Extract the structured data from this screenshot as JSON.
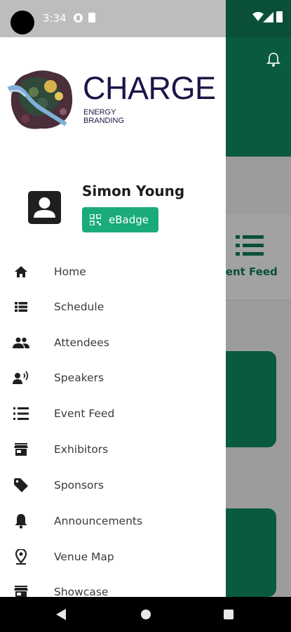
{
  "status_bar": {
    "time": "3:34"
  },
  "background_screen": {
    "tab_label": "vent Feed"
  },
  "brand": {
    "name": "CHARGE",
    "sub_line1": "ENERGY",
    "sub_line2": "BRANDING"
  },
  "user": {
    "name": "Simon Young",
    "badge_label": "eBadge"
  },
  "menu": {
    "items": [
      {
        "label": "Home",
        "icon": "home-icon"
      },
      {
        "label": "Schedule",
        "icon": "schedule-icon"
      },
      {
        "label": "Attendees",
        "icon": "people-icon"
      },
      {
        "label": "Speakers",
        "icon": "speaker-icon"
      },
      {
        "label": "Event Feed",
        "icon": "list-icon"
      },
      {
        "label": "Exhibitors",
        "icon": "store-icon"
      },
      {
        "label": "Sponsors",
        "icon": "tag-icon"
      },
      {
        "label": "Announcements",
        "icon": "bell-icon"
      },
      {
        "label": "Venue Map",
        "icon": "map-pin-icon"
      },
      {
        "label": "Showcase",
        "icon": "store-icon"
      }
    ]
  },
  "colors": {
    "accent": "#1aab7c",
    "brand_dark": "#0a5a41",
    "logo_text": "#1a1648"
  }
}
